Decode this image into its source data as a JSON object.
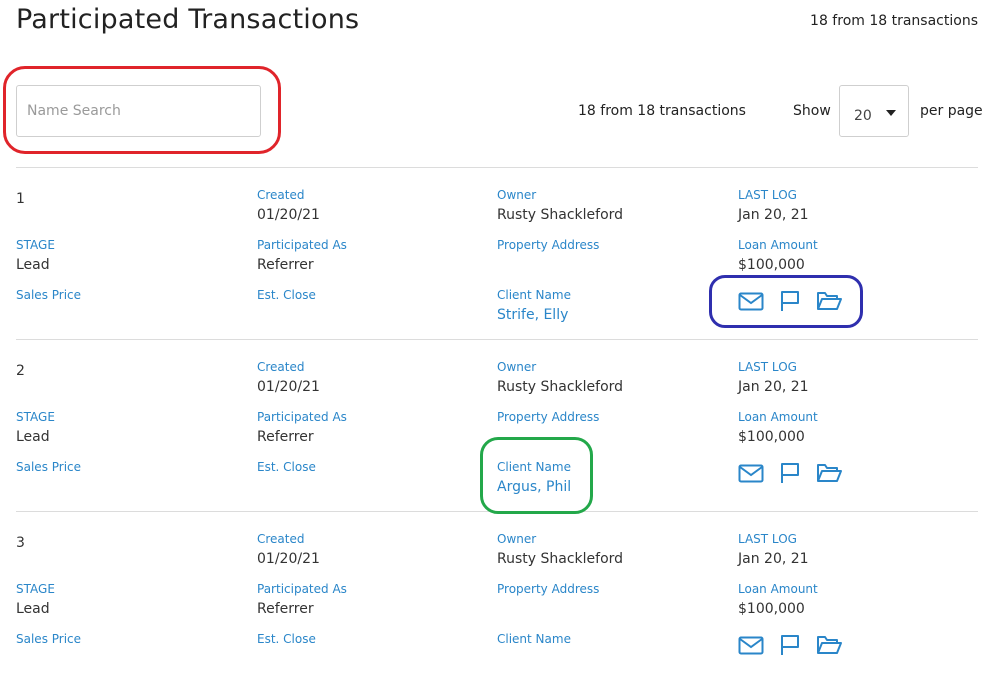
{
  "header": {
    "title": "Participated Transactions",
    "count_text": "18 from 18 transactions"
  },
  "controls": {
    "search_placeholder": "Name Search",
    "count_text": "18 from 18 transactions",
    "show_label": "Show",
    "per_page_value": "20",
    "per_page_label": "per page"
  },
  "labels": {
    "created": "Created",
    "owner": "Owner",
    "last_log": "LAST LOG",
    "stage": "STAGE",
    "participated_as": "Participated As",
    "property_address": "Property Address",
    "loan_amount": "Loan Amount",
    "sales_price": "Sales Price",
    "est_close": "Est. Close",
    "client_name": "Client Name"
  },
  "records": [
    {
      "number": "1",
      "created": "01/20/21",
      "owner": "Rusty Shackleford",
      "last_log": "Jan 20, 21",
      "stage": "Lead",
      "participated_as": "Referrer",
      "property_address": "",
      "loan_amount": "$100,000",
      "sales_price": "",
      "est_close": "",
      "client_name": "Strife, Elly"
    },
    {
      "number": "2",
      "created": "01/20/21",
      "owner": "Rusty Shackleford",
      "last_log": "Jan 20, 21",
      "stage": "Lead",
      "participated_as": "Referrer",
      "property_address": "",
      "loan_amount": "$100,000",
      "sales_price": "",
      "est_close": "",
      "client_name": "Argus, Phil"
    },
    {
      "number": "3",
      "created": "01/20/21",
      "owner": "Rusty Shackleford",
      "last_log": "Jan 20, 21",
      "stage": "Lead",
      "participated_as": "Referrer",
      "property_address": "",
      "loan_amount": "$100,000",
      "sales_price": "",
      "est_close": "",
      "client_name": ""
    }
  ],
  "icons": {
    "email": "envelope-icon",
    "flag": "flag-icon",
    "folder": "folder-open-icon"
  },
  "colors": {
    "link": "#2a86c9",
    "annotation_red": "#e0242a",
    "annotation_blue": "#2f2fae",
    "annotation_green": "#23a84a"
  }
}
